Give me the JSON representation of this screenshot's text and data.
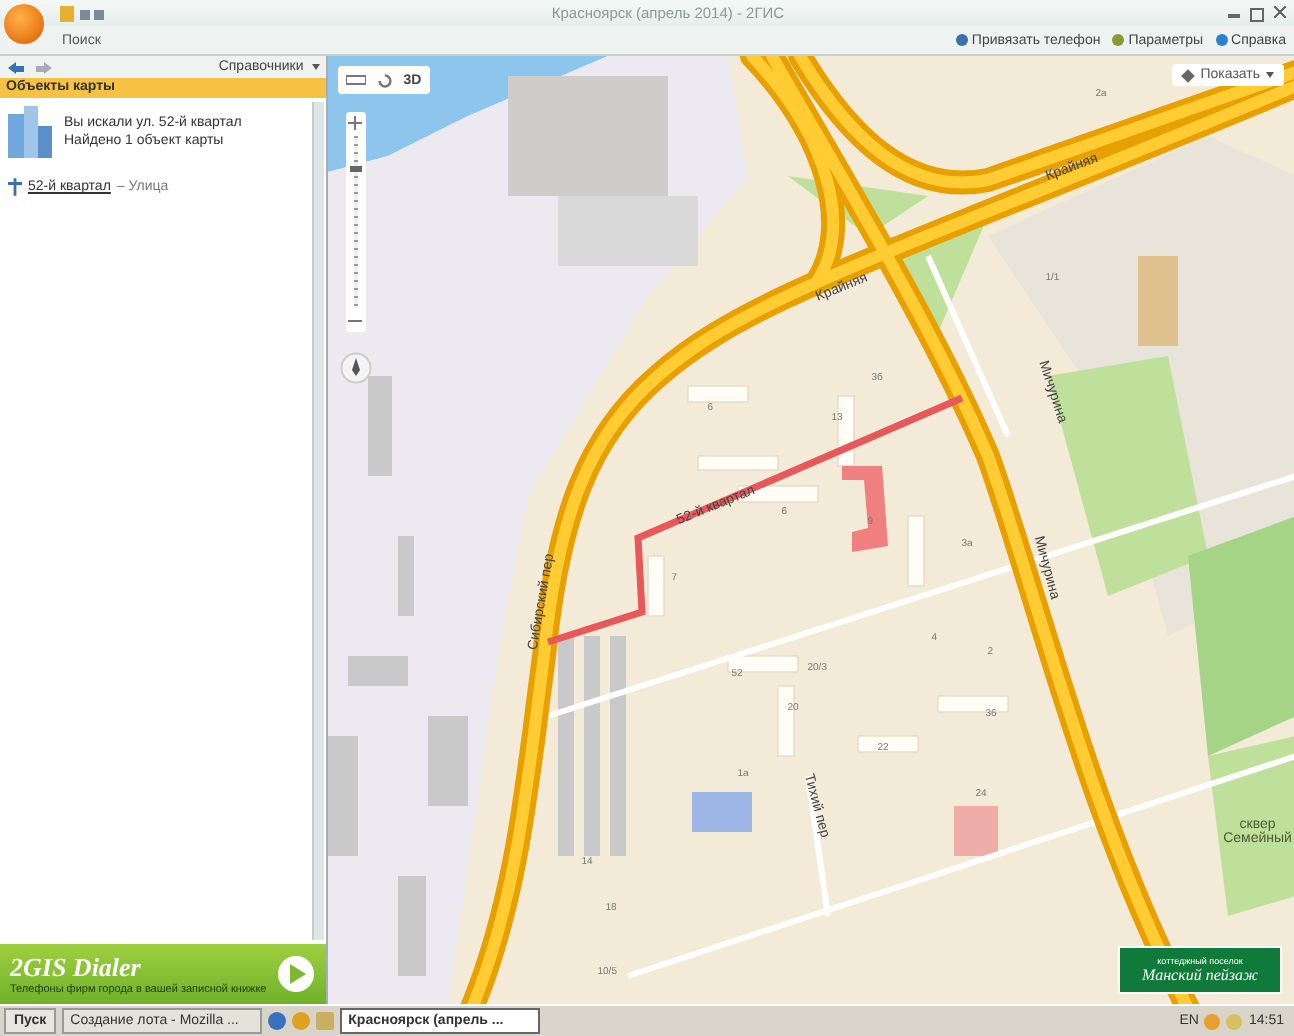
{
  "window": {
    "title": "Красноярск (апрель 2014) - 2ГИС"
  },
  "ribbon": {
    "search_tab": "Поиск",
    "links": [
      "Привязать телефон",
      "Параметры",
      "Справка"
    ]
  },
  "sidebar": {
    "directories_button": "Справочники",
    "header": "Объекты карты",
    "query": "Вы искали ул. 52-й квартал",
    "found": "Найдено 1 объект карты",
    "results": [
      {
        "name": "52-й квартал",
        "type": "– Улица"
      }
    ]
  },
  "banner": {
    "title": "2GIS Dialer",
    "subtitle": "Телефоны фирм города в вашей записной книжке"
  },
  "map": {
    "mode_button": "3D",
    "show_button": "Показать",
    "zoom": {
      "level": 0.8
    },
    "streets": [
      "Крайняя",
      "Крайняя",
      "Мичурина",
      "Мичурина",
      "Сибирский пер",
      "52-й квартал",
      "Тихий пер",
      "сквер Семейный"
    ],
    "house_numbers": [
      "2а",
      "1/1",
      "3б",
      "13",
      "6",
      "6",
      "9",
      "7",
      "3а",
      "52",
      "20/3",
      "20",
      "22",
      "36",
      "24",
      "1а",
      "14",
      "18",
      "4",
      "2",
      "10/5"
    ],
    "ad": {
      "line1": "коттеджный поселок",
      "line2": "Манский пейзаж"
    }
  },
  "taskbar": {
    "start": "Пуск",
    "tasks": [
      {
        "label": "Создание лота - Mozilla ...",
        "selected": false
      },
      {
        "label": "Красноярск (апрель ...",
        "selected": true
      }
    ],
    "language": "EN",
    "clock": "14:51"
  }
}
